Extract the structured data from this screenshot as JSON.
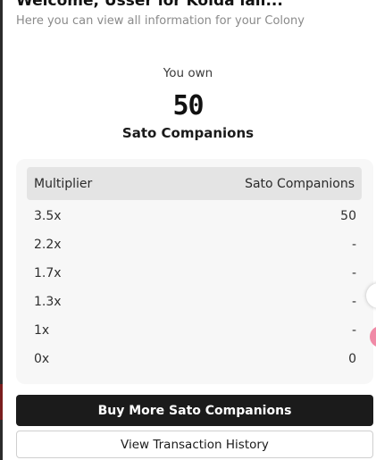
{
  "header": {
    "title": "Welcome, Usser lor Kolda lall...",
    "subtitle": "Here you can view all information for your Colony"
  },
  "ownership": {
    "label": "You own",
    "count": "50",
    "item_name": "Sato Companions"
  },
  "multiplier_table": {
    "columns": [
      "Multiplier",
      "Sato Companions"
    ],
    "rows": [
      {
        "multiplier": "3.5x",
        "count": "50"
      },
      {
        "multiplier": "2.2x",
        "count": "-"
      },
      {
        "multiplier": "1.7x",
        "count": "-"
      },
      {
        "multiplier": "1.3x",
        "count": "-"
      },
      {
        "multiplier": "1x",
        "count": "-"
      },
      {
        "multiplier": "0x",
        "count": "0"
      }
    ]
  },
  "actions": {
    "buy_label": "Buy More Sato Companions",
    "history_label": "View Transaction History"
  },
  "colors": {
    "primary_button": "#1b1b1b",
    "table_background": "#f7f7f7",
    "table_header": "#e4e4e4",
    "accent_pink": "#f08aa6"
  }
}
